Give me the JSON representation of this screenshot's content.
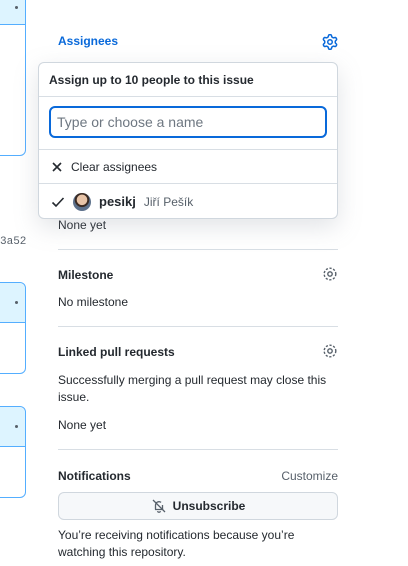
{
  "left_edge": {
    "sha_fragment": "3a52"
  },
  "sidebar": {
    "assignees": {
      "title": "Assignees",
      "value": "None yet"
    },
    "milestone": {
      "title": "Milestone",
      "value": "No milestone"
    },
    "linked_prs": {
      "title": "Linked pull requests",
      "description": "Successfully merging a pull request may close this issue.",
      "value": "None yet"
    },
    "notifications": {
      "title": "Notifications",
      "customize_label": "Customize",
      "unsubscribe_label": "Unsubscribe",
      "reason": "You’re receiving notifications because you’re watching this repository."
    }
  },
  "assignee_popover": {
    "header": "Assign up to 10 people to this issue",
    "search_placeholder": "Type or choose a name",
    "clear_label": "Clear assignees",
    "users": [
      {
        "login": "pesikj",
        "name": "Jiří Pešík",
        "selected": true
      }
    ]
  },
  "colors": {
    "accent": "#0969da",
    "border": "#d0d7de"
  }
}
